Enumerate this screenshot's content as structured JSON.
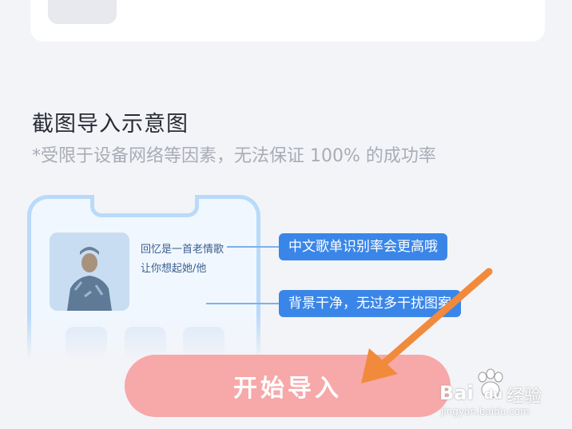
{
  "section": {
    "title": "截图导入示意图",
    "subtitle": "*受限于设备网络等因素，无法保证 100% 的成功率"
  },
  "illustration": {
    "lyric_line1": "回忆是一首老情歌",
    "lyric_line2": "让你想起她/他",
    "tag_top": "中文歌单识别率会更高哦",
    "tag_bottom": "背景干净，无过多干扰图案"
  },
  "actions": {
    "start_import": "开始导入"
  },
  "watermark": {
    "brand": "Bai",
    "brand_tail": "du",
    "cn": "经验",
    "url": "jingyan.baidu.com"
  },
  "colors": {
    "accent_blue": "#3a86e8",
    "button_pink": "#f7a8a8",
    "arrow_orange": "#f28a3c"
  }
}
